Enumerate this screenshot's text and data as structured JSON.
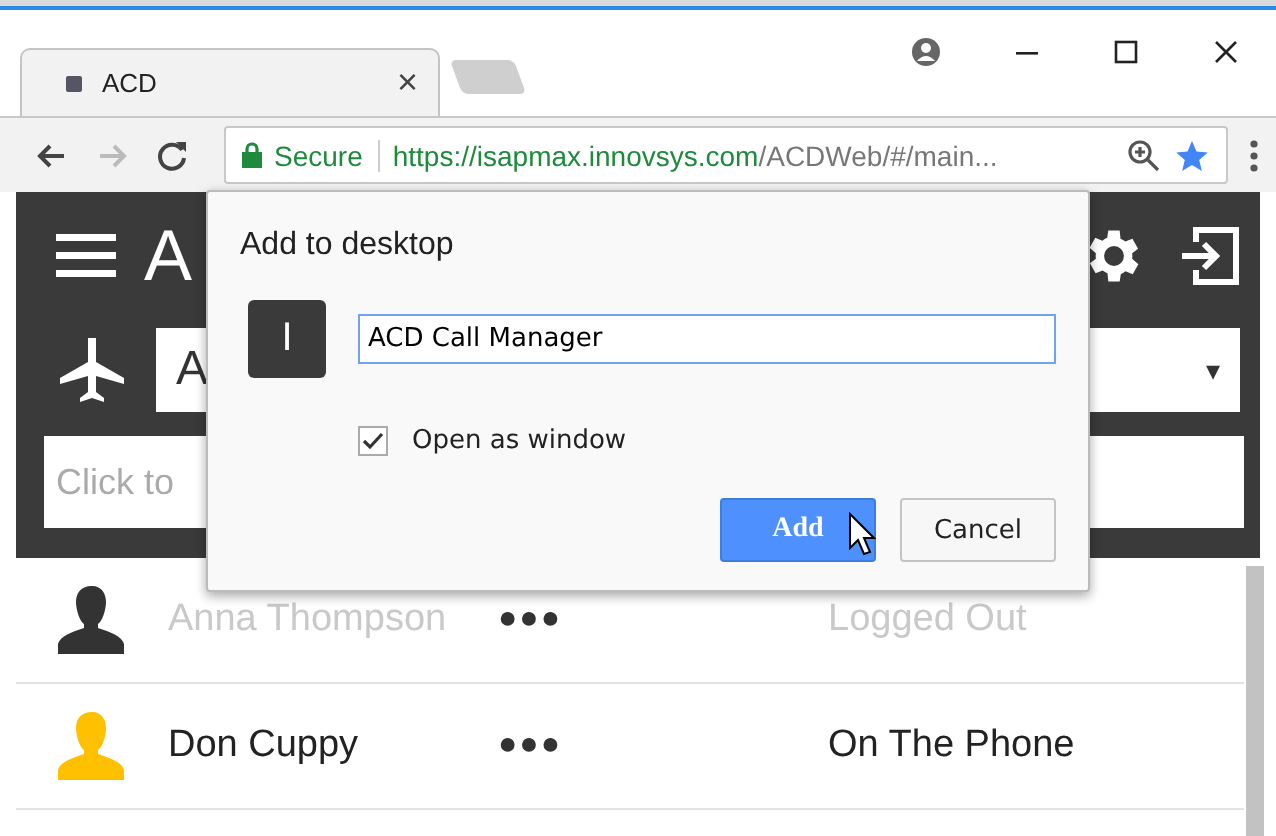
{
  "browser": {
    "tab": {
      "title": "ACD",
      "close": "×"
    },
    "address": {
      "secure_label": "Secure",
      "url_host": "https://isapmax.innovsys.com",
      "url_path": "/ACDWeb/#/main..."
    }
  },
  "app": {
    "title": "A",
    "select_value": "A",
    "select_caret": "▾",
    "search_placeholder": "Click to"
  },
  "agents": [
    {
      "name": "Anna Thompson",
      "presence": "●●●",
      "status": "Logged Out",
      "disabled": true,
      "color": "#333333"
    },
    {
      "name": "Don Cuppy",
      "presence": "●●●",
      "status": "On The Phone",
      "disabled": false,
      "color": "#ffc000"
    }
  ],
  "dialog": {
    "title": "Add to desktop",
    "icon_letter": "I",
    "name_value": "ACD Call Manager",
    "open_as_window": {
      "label": "Open as window",
      "checked": true
    },
    "buttons": [
      {
        "label": "Add",
        "kind": "primary"
      },
      {
        "label": "Cancel",
        "kind": "secondary"
      }
    ]
  }
}
